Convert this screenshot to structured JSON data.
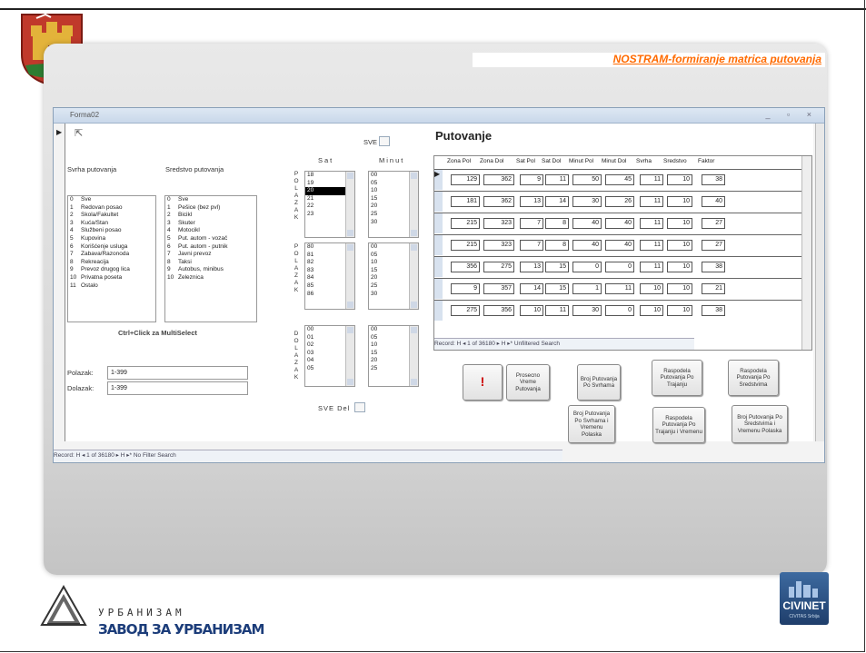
{
  "slide": {
    "title": "NOSTRAM-formiranje matrica putovanja"
  },
  "window": {
    "title": "Forma02",
    "controls": "_ ▫ ×"
  },
  "form": {
    "header": "Putovanje",
    "sve_label": "SVE",
    "sve_del_label": "SVE Del",
    "sat_label": "Sat",
    "minut_label": "Minut",
    "side_dolazak": [
      "D",
      "O",
      "L",
      "A",
      "Z",
      "A",
      "K"
    ],
    "side_pol": [
      "P",
      "O",
      "L",
      "A",
      "Z",
      "A",
      "K"
    ],
    "svrha_label": "Svrha putovanja",
    "sredstvo_label": "Sredstvo putovanja",
    "svrha_items": [
      {
        "n": "0",
        "t": "Sve"
      },
      {
        "n": "1",
        "t": "Redovan posao"
      },
      {
        "n": "2",
        "t": "Škola/Fakultet"
      },
      {
        "n": "3",
        "t": "Kuća/Stan"
      },
      {
        "n": "4",
        "t": "Službeni posao"
      },
      {
        "n": "5",
        "t": "Kupovina"
      },
      {
        "n": "6",
        "t": "Korišćenje usluga"
      },
      {
        "n": "7",
        "t": "Zabava/Razonoda"
      },
      {
        "n": "8",
        "t": "Rekreacija"
      },
      {
        "n": "9",
        "t": "Prevoz drugog lica"
      },
      {
        "n": "10",
        "t": "Privatna poseta"
      },
      {
        "n": "11",
        "t": "Ostalo"
      }
    ],
    "sredstvo_items": [
      {
        "n": "0",
        "t": "Sve"
      },
      {
        "n": "1",
        "t": "Pešice (bez pvl)"
      },
      {
        "n": "2",
        "t": "Bicikl"
      },
      {
        "n": "3",
        "t": "Skuter"
      },
      {
        "n": "4",
        "t": "Motocikl"
      },
      {
        "n": "5",
        "t": "Put. autom - vozač"
      },
      {
        "n": "6",
        "t": "Put. autom - putnik"
      },
      {
        "n": "7",
        "t": "Javni prevoz"
      },
      {
        "n": "8",
        "t": "Taksi"
      },
      {
        "n": "9",
        "t": "Autobus, minibus"
      },
      {
        "n": "10",
        "t": "Železnica"
      }
    ],
    "multiselect_hint": "Ctrl+Click za MultiSelect",
    "sat_pol": [
      "18",
      "19",
      "20",
      "21",
      "22",
      "23"
    ],
    "sat_pol_selected": 2,
    "minut_pol": [
      "00",
      "05",
      "10",
      "15",
      "20",
      "25",
      "30"
    ],
    "sat_pol2": [
      "80",
      "81",
      "82",
      "83",
      "84",
      "85",
      "86"
    ],
    "minut_pol2": [
      "00",
      "05",
      "10",
      "15",
      "20",
      "25",
      "30"
    ],
    "sat_dol": [
      "00",
      "01",
      "02",
      "03",
      "04",
      "05"
    ],
    "minut_dol": [
      "00",
      "05",
      "10",
      "15",
      "20",
      "25"
    ],
    "polazak_label": "Polazak:",
    "polazak_value": "1-399",
    "dolazak_label": "Dolazak:",
    "dolazak_value": "1-399",
    "record_nav": "Record: H  ◂  1 of 36180  ▸  H  ▸*   No Filter   Search"
  },
  "grid": {
    "columns": [
      "Zona Pol",
      "Zona Dol",
      "Sat Pol",
      "Sat Dol",
      "Minut Pol",
      "Minut Dol",
      "Svrha",
      "Sredstvo",
      "Faktor"
    ],
    "rows": [
      [
        "129",
        "362",
        "9",
        "11",
        "50",
        "45",
        "11",
        "10",
        "38"
      ],
      [
        "181",
        "362",
        "13",
        "14",
        "30",
        "26",
        "11",
        "10",
        "40"
      ],
      [
        "215",
        "323",
        "7",
        "8",
        "40",
        "40",
        "11",
        "10",
        "27"
      ],
      [
        "215",
        "323",
        "7",
        "8",
        "40",
        "40",
        "11",
        "10",
        "27"
      ],
      [
        "356",
        "275",
        "13",
        "15",
        "0",
        "0",
        "11",
        "10",
        "38"
      ],
      [
        "9",
        "357",
        "14",
        "15",
        "1",
        "11",
        "10",
        "10",
        "21"
      ],
      [
        "275",
        "356",
        "10",
        "11",
        "30",
        "0",
        "10",
        "10",
        "38"
      ]
    ],
    "nav": "Record: H  ◂  1 of 36180  ▸  H  ▸*   Unfiltered   Search"
  },
  "buttons": {
    "run": "!",
    "prosecno": "Prosecno Vreme Putovanja",
    "broj_svrha": "Broj Putovanja Po Svrhama",
    "raspodela_trajanju": "Raspodela Putovanja Po Trajanju",
    "raspodela_sredstvima": "Raspodela Putovanja Po Sredstvima",
    "broj_svrha_vreme": "Broj Putovanja Po Svrhama i Vremenu Polaska",
    "raspodela_trajanju_vreme": "Raspodela Putovanja Po Trajanju i Vremenu",
    "broj_sredstva_vreme": "Broj Putovanja Po Sredstvima i Vremenu Polaska"
  },
  "footer": {
    "urb_top": "УРБАНИЗАМ",
    "urb_bottom": "ЗАВОД ЗА УРБАНИЗАМ",
    "civinet": "CIVINET",
    "civinet_sub": "CIVITAS Srbija"
  }
}
